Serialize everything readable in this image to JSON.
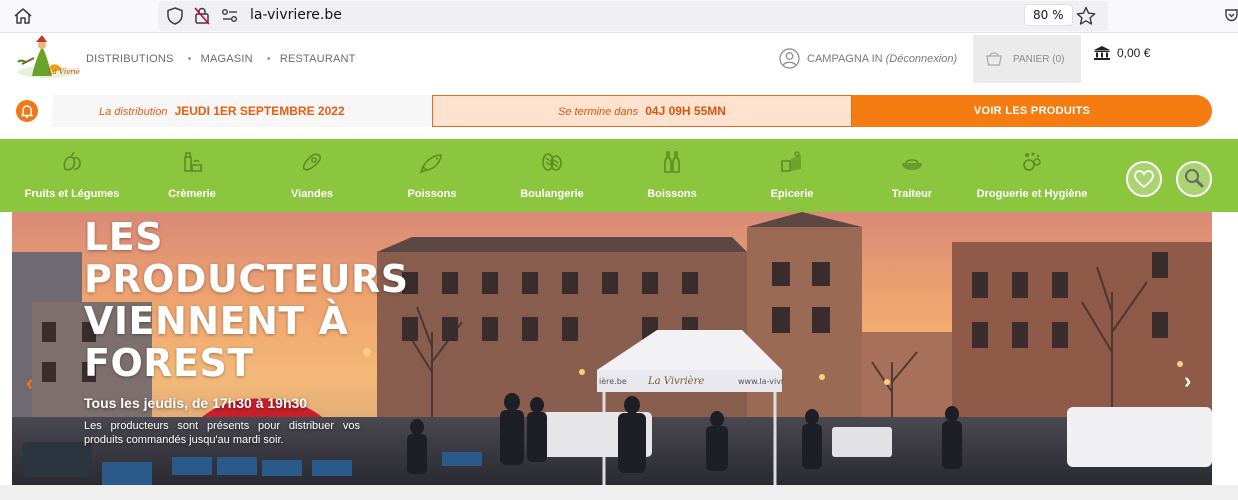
{
  "browser": {
    "url": "la-vivriere.be",
    "zoom": "80 %"
  },
  "header": {
    "nav": [
      "DISTRIBUTIONS",
      "MAGASIN",
      "RESTAURANT"
    ],
    "nav_separator": "•",
    "user_name": "CAMPAGNA IN",
    "disconnect": "(Déconnexion)",
    "cart_label": "PANIER (0)",
    "balance": "0,00 €"
  },
  "distribution": {
    "prefix": "La distribution",
    "date": "JEUDI 1ER SEPTEMBRE 2022",
    "countdown_prefix": "Se termine dans",
    "countdown": "04J 09H 55MN",
    "cta": "VOIR LES PRODUITS"
  },
  "categories": [
    {
      "label": "Fruits et Légumes",
      "icon": "fruits-vegetables-icon"
    },
    {
      "label": "Crèmerie",
      "icon": "dairy-icon"
    },
    {
      "label": "Viandes",
      "icon": "meat-icon"
    },
    {
      "label": "Poissons",
      "icon": "fish-icon"
    },
    {
      "label": "Boulangerie",
      "icon": "bread-icon"
    },
    {
      "label": "Boissons",
      "icon": "bottles-icon"
    },
    {
      "label": "Epicerie",
      "icon": "grocery-icon"
    },
    {
      "label": "Traiteur",
      "icon": "dish-icon"
    },
    {
      "label": "Droguerie et Hygiène",
      "icon": "hygiene-icon"
    }
  ],
  "hero": {
    "title": "LES PRODUCTEURS VIENNENT À FOREST",
    "subtitle": "Tous les jeudis, de 17h30 à 19h30",
    "text": "Les producteurs sont présents pour distribuer vos produits commandés jusqu'au mardi soir.",
    "tent_text_left": "ière.be",
    "tent_text_mid": "La Vivrière",
    "tent_text_right": "www.la-vivr"
  },
  "colors": {
    "orange": "#f47c10",
    "green": "#8cc63f",
    "countdown_bg": "#fde3cf"
  }
}
